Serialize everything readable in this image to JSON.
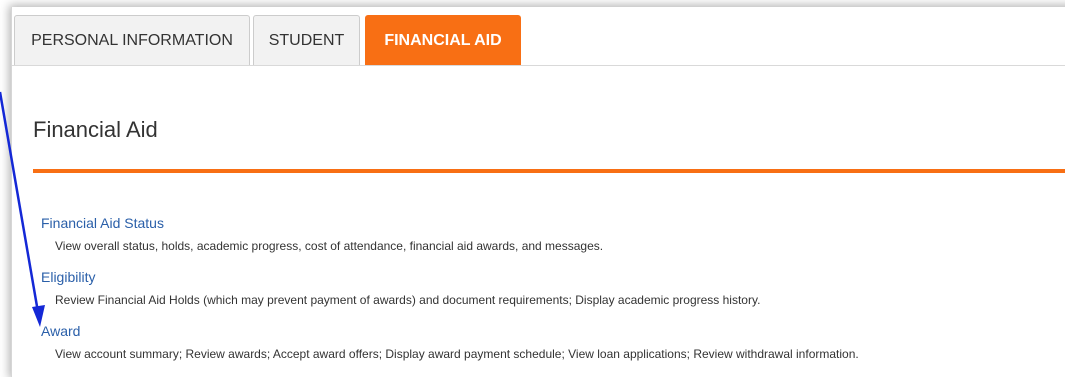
{
  "tabs": {
    "personal": "PERSONAL INFORMATION",
    "student": "STUDENT",
    "financial": "FINANCIAL AID"
  },
  "page": {
    "title": "Financial Aid"
  },
  "items": [
    {
      "link": "Financial Aid Status",
      "description": "View overall status, holds, academic progress, cost of attendance, financial aid awards, and messages."
    },
    {
      "link": "Eligibility",
      "description": "Review Financial Aid Holds (which may prevent payment of awards) and document requirements; Display academic progress history."
    },
    {
      "link": "Award",
      "description": "View account summary; Review awards; Accept award offers; Display award payment schedule; View loan applications; Review withdrawal information."
    }
  ],
  "colors": {
    "accent": "#f86f14",
    "link": "#2a5fa9",
    "annotation_arrow": "#1428d6"
  }
}
